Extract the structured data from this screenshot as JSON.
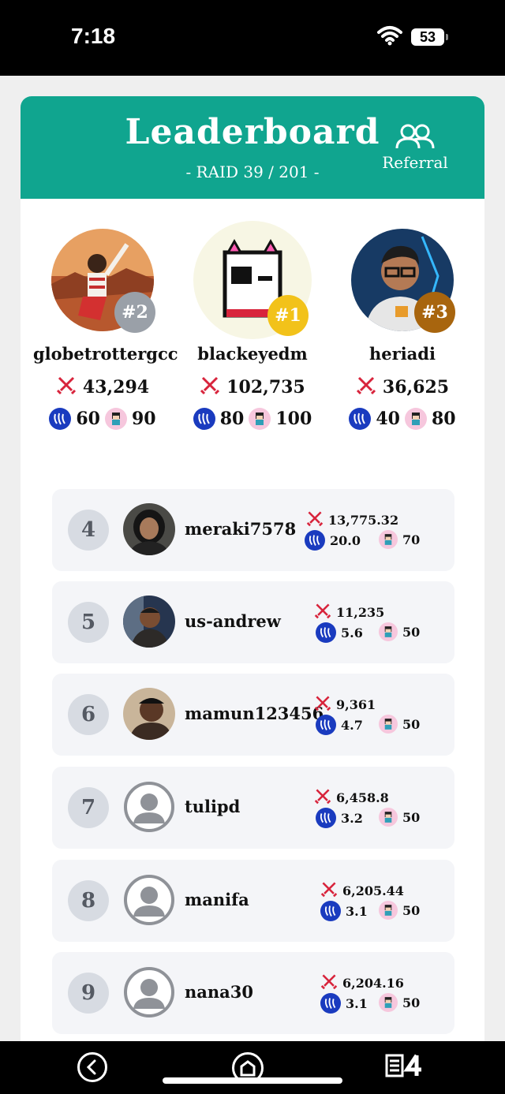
{
  "status_bar": {
    "time": "7:18",
    "battery": "53"
  },
  "header": {
    "title": "Leaderboard",
    "subtitle": "- RAID 39 / 201 -",
    "referral_label": "Referral"
  },
  "podium": [
    {
      "rank": "#2",
      "name": "globetrottergcc",
      "score": "43,294",
      "steem": "60",
      "buddy": "90"
    },
    {
      "rank": "#1",
      "name": "blackeyedm",
      "score": "102,735",
      "steem": "80",
      "buddy": "100"
    },
    {
      "rank": "#3",
      "name": "heriadi",
      "score": "36,625",
      "steem": "40",
      "buddy": "80"
    }
  ],
  "rows": [
    {
      "rank": "4",
      "name": "meraki7578",
      "score": "13,775.32",
      "steem": "20.0",
      "buddy": "70"
    },
    {
      "rank": "5",
      "name": "us-andrew",
      "score": "11,235",
      "steem": "5.6",
      "buddy": "50"
    },
    {
      "rank": "6",
      "name": "mamun123456",
      "score": "9,361",
      "steem": "4.7",
      "buddy": "50"
    },
    {
      "rank": "7",
      "name": "tulipd",
      "score": "6,458.8",
      "steem": "3.2",
      "buddy": "50"
    },
    {
      "rank": "8",
      "name": "manifa",
      "score": "6,205.44",
      "steem": "3.1",
      "buddy": "50"
    },
    {
      "rank": "9",
      "name": "nana30",
      "score": "6,204.16",
      "steem": "3.1",
      "buddy": "50"
    }
  ],
  "colors": {
    "header": "#10a58f",
    "rank1": "#f2c21a",
    "rank2": "#9aa0a8",
    "rank3": "#a8650e",
    "steem": "#1a3bbf",
    "sword": "#d8243c"
  },
  "icons": [
    "wifi-icon",
    "referral-icon",
    "sword-icon",
    "steem-icon",
    "buddy-icon",
    "back-icon",
    "home-icon",
    "tabs-icon"
  ]
}
